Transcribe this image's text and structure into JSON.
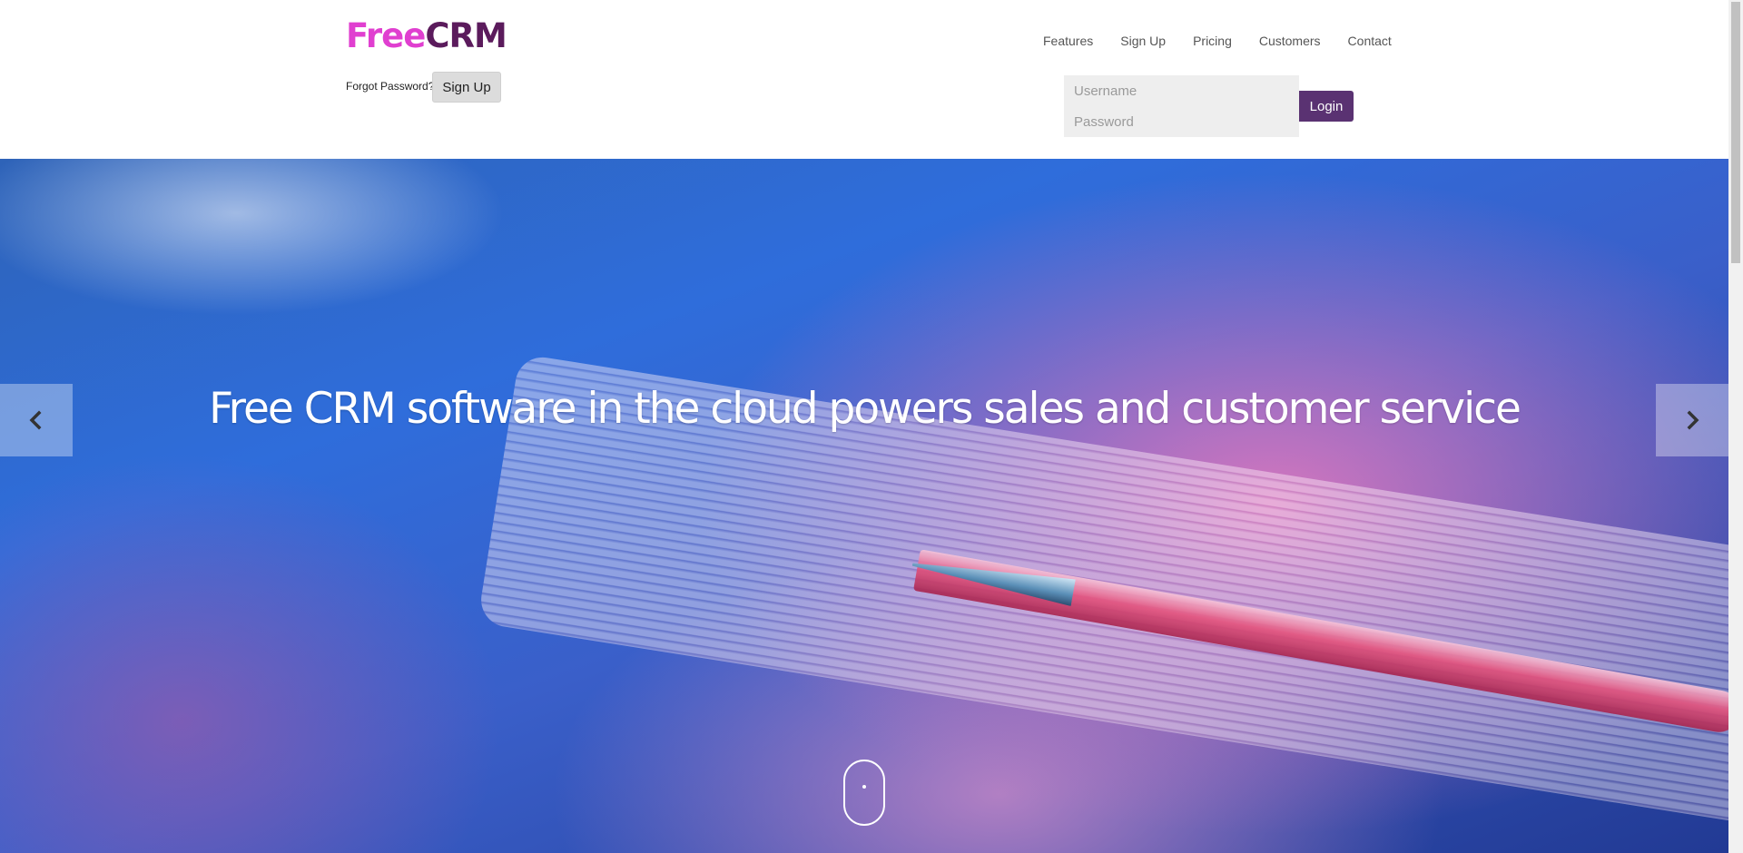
{
  "logo": {
    "part1": "Free",
    "part2": "CRM"
  },
  "header": {
    "forgot_password": "Forgot Password?",
    "signup_button": "Sign Up"
  },
  "nav": {
    "items": [
      {
        "label": "Features"
      },
      {
        "label": "Sign Up"
      },
      {
        "label": "Pricing"
      },
      {
        "label": "Customers"
      },
      {
        "label": "Contact"
      }
    ]
  },
  "login": {
    "username_placeholder": "Username",
    "password_placeholder": "Password",
    "button": "Login"
  },
  "hero": {
    "title": "Free CRM software in the cloud powers sales and customer service",
    "prev_icon": "chevron-left-icon",
    "next_icon": "chevron-right-icon",
    "scroll_icon": "scroll-mouse-icon"
  },
  "colors": {
    "logo_free": "#e03fd0",
    "logo_crm": "#5b1b5c",
    "login_button": "#5a3272"
  }
}
